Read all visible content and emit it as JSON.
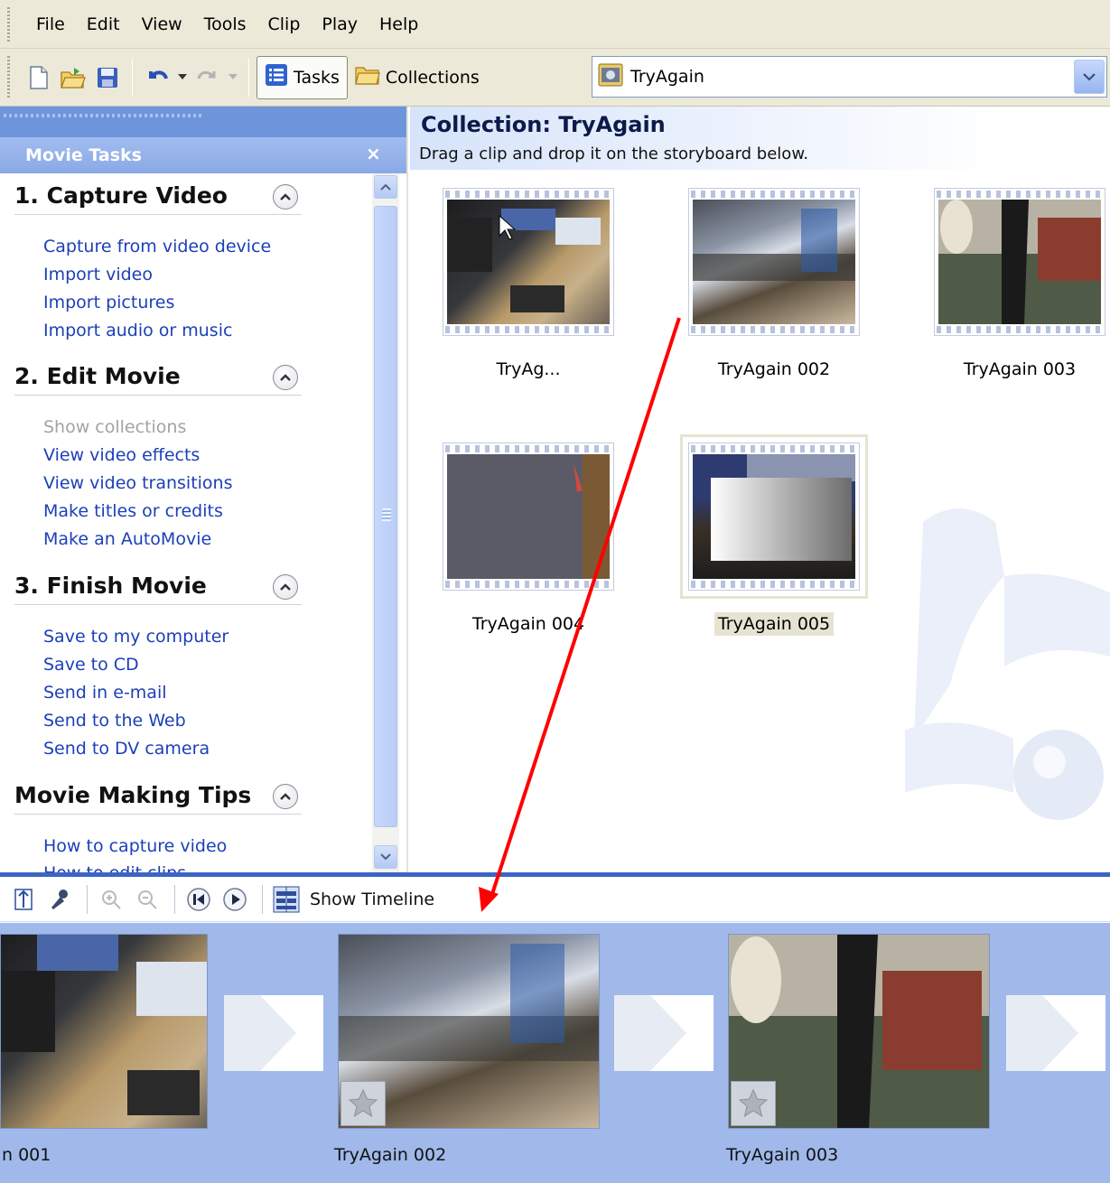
{
  "menu": [
    "File",
    "Edit",
    "View",
    "Tools",
    "Clip",
    "Play",
    "Help"
  ],
  "toolbar": {
    "tasks_label": "Tasks",
    "collections_label": "Collections",
    "collection_select_value": "TryAgain"
  },
  "taskpane": {
    "title": "Movie Tasks",
    "close_glyph": "×",
    "sections": [
      {
        "name": "1. Capture Video",
        "links": [
          "Capture from video device",
          "Import video",
          "Import pictures",
          "Import audio or music"
        ]
      },
      {
        "name": "2. Edit Movie",
        "links": [
          "Show collections",
          "View video effects",
          "View video transitions",
          "Make titles or credits",
          "Make an AutoMovie"
        ]
      },
      {
        "name": "3. Finish Movie",
        "links": [
          "Save to my computer",
          "Save to CD",
          "Send in e-mail",
          "Send to the Web",
          "Send to DV camera"
        ]
      },
      {
        "name": "Movie Making Tips",
        "links": [
          "How to capture video",
          "How to edit clips"
        ]
      }
    ]
  },
  "collection": {
    "title": "Collection: TryAgain",
    "subtitle": "Drag a clip and drop it on the storyboard below.",
    "clips": [
      {
        "name": "TryAg..."
      },
      {
        "name": "TryAgain 002"
      },
      {
        "name": "TryAgain 003"
      },
      {
        "name": "TryAgain 004"
      },
      {
        "name": "TryAgain 005",
        "selected": true
      }
    ]
  },
  "storyboard": {
    "show_timeline_label": "Show Timeline",
    "clips": [
      {
        "name": "n 001"
      },
      {
        "name": "TryAgain 002"
      },
      {
        "name": "TryAgain 003"
      }
    ]
  },
  "colors": {
    "link": "#1c3fb8",
    "task_header": "#8aa9e6",
    "storyboard_bg": "#a0b9ea",
    "annotation_arrow": "#ff0000"
  },
  "icons": [
    "new-project-icon",
    "open-project-icon",
    "save-project-icon",
    "undo-icon",
    "redo-icon",
    "tasks-icon",
    "collections-folder-icon",
    "collection-film-icon",
    "dropdown-arrow-icon",
    "close-icon",
    "collapse-section-icon",
    "storyboard-audio-levels-icon",
    "narrate-icon",
    "zoom-in-icon",
    "zoom-out-icon",
    "rewind-icon",
    "play-icon",
    "timeline-icon",
    "video-effects-star-icon"
  ]
}
